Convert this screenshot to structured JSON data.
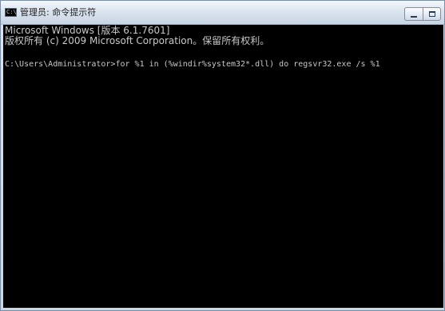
{
  "window": {
    "icon_text": "C:\\",
    "title": "管理员: 命令提示符",
    "icons": {
      "app": "command-prompt-icon",
      "minimize": "minimize-icon",
      "maximize": "maximize-icon"
    }
  },
  "console": {
    "lines": [
      "Microsoft Windows [版本 6.1.7601]",
      "版权所有 (c) 2009 Microsoft Corporation。保留所有权利。",
      "C:\\Users\\Administrator>for %1 in (%windir%system32*.dll) do regsvr32.exe /s %1"
    ]
  },
  "colors": {
    "console_bg": "#000000",
    "console_text": "#c8c8c8"
  }
}
